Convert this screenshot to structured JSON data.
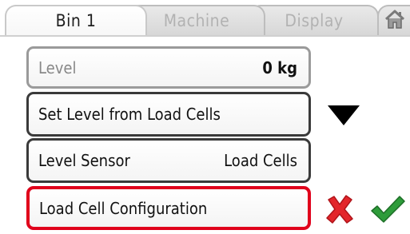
{
  "tabs": [
    {
      "label": "Bin 1",
      "active": true
    },
    {
      "label": "Machine",
      "active": false
    },
    {
      "label": "Display",
      "active": false
    }
  ],
  "home_icon": "home-icon",
  "fields": {
    "level": {
      "label": "Level",
      "value": "0 kg"
    },
    "set_level": {
      "label": "Set Level from Load Cells"
    },
    "level_sensor": {
      "label": "Level Sensor",
      "value": "Load Cells"
    },
    "load_cell_config": {
      "label": "Load Cell Configuration"
    }
  },
  "buttons": {
    "dropdown_icon": "triangle-down-icon",
    "cancel_icon": "x-icon",
    "confirm_icon": "check-icon"
  },
  "colors": {
    "selected_border": "#e0001b",
    "cancel": "#e3262b",
    "confirm": "#2e9c3a"
  }
}
